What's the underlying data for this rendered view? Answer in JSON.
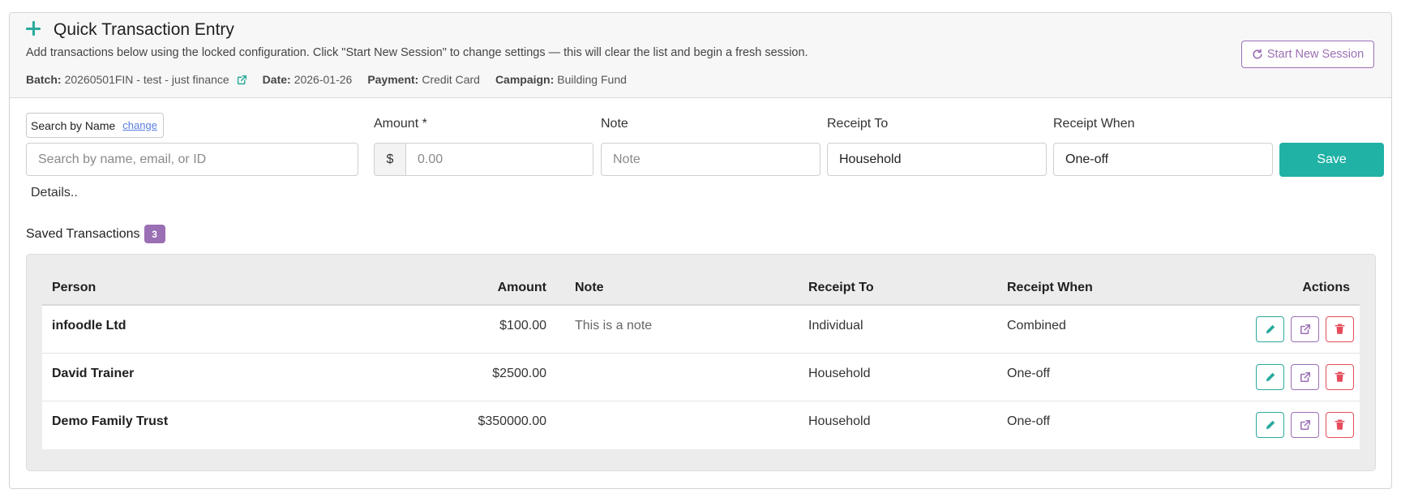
{
  "header": {
    "title": "Quick Transaction Entry",
    "subtitle": "Add transactions below using the locked configuration. Click \"Start New Session\" to change settings — this will clear the list and begin a fresh session.",
    "batch_label": "Batch:",
    "batch_value": "20260501FIN - test - just finance",
    "date_label": "Date:",
    "date_value": "2026-01-26",
    "payment_label": "Payment:",
    "payment_value": "Credit Card",
    "campaign_label": "Campaign:",
    "campaign_value": "Building Fund",
    "start_session_label": "Start New Session"
  },
  "form": {
    "search_mode_label": "Search by Name",
    "change_link": "change",
    "search_placeholder": "Search by name, email, or ID",
    "amount_label": "Amount *",
    "currency_symbol": "$",
    "amount_placeholder": "0.00",
    "note_label": "Note",
    "note_placeholder": "Note",
    "receipt_to_label": "Receipt To",
    "receipt_to_value": "Household",
    "receipt_when_label": "Receipt When",
    "receipt_when_value": "One-off",
    "save_label": "Save",
    "details_label": "Details.."
  },
  "saved": {
    "title": "Saved Transactions",
    "count": "3",
    "columns": {
      "person": "Person",
      "amount": "Amount",
      "note": "Note",
      "receipt_to": "Receipt To",
      "receipt_when": "Receipt When",
      "actions": "Actions"
    },
    "rows": [
      {
        "person": "infoodle Ltd",
        "amount": "$100.00",
        "note": "This is a note",
        "receipt_to": "Individual",
        "receipt_when": "Combined"
      },
      {
        "person": "David Trainer",
        "amount": "$2500.00",
        "note": "",
        "receipt_to": "Household",
        "receipt_when": "One-off"
      },
      {
        "person": "Demo Family Trust",
        "amount": "$350000.00",
        "note": "",
        "receipt_to": "Household",
        "receipt_when": "One-off"
      }
    ]
  },
  "colors": {
    "teal": "#20b2a5",
    "purple": "#9b6fb4",
    "red": "#e54d5c"
  },
  "icons": {
    "title": "plus-icon",
    "batch_link": "external-link-icon",
    "session": "refresh-icon",
    "edit": "pencil-icon",
    "open": "external-link-icon",
    "delete": "trash-icon"
  }
}
